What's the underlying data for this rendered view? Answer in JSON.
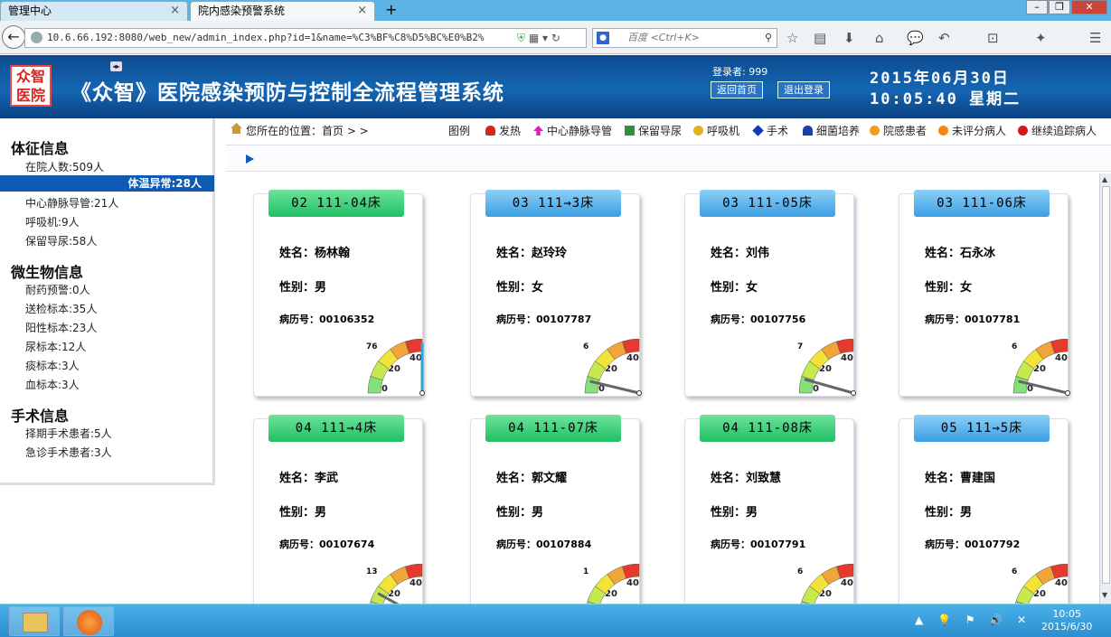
{
  "browser": {
    "tabs": [
      {
        "label": "管理中心"
      },
      {
        "label": "院内感染预警系统"
      }
    ],
    "new_tab": "+",
    "close_glyph": "×",
    "url": "10.6.66.192:8080/web_new/admin_index.php?id=1&name=%C3%BF%C8%D5%BC%E0%B2%",
    "search_placeholder": "百度 <Ctrl+K>",
    "window_buttons": {
      "min": "–",
      "max": "❐",
      "close": "✕"
    }
  },
  "header": {
    "title": "《众智》医院感染预防与控制全流程管理系统",
    "logo_text": "众智\n医院",
    "login_label": "登录者: 999",
    "home_button": "返回首页",
    "logout_button": "退出登录",
    "date": "2015年06月30日",
    "time": "10:05:40 星期二"
  },
  "sidebar": {
    "sections": [
      {
        "title": "体征信息",
        "items": [
          "在院人数:509人",
          "体温异常:28人",
          "中心静脉导管:21人",
          "呼吸机:9人",
          "保留导尿:58人"
        ]
      },
      {
        "title": "微生物信息",
        "items": [
          "耐药预警:0人",
          "送检标本:35人",
          "阳性标本:23人",
          "尿标本:12人",
          "痰标本:3人",
          "血标本:3人"
        ]
      },
      {
        "title": "手术信息",
        "items": [
          "择期手术患者:5人",
          "急诊手术患者:3人"
        ]
      }
    ],
    "active_item": "体温异常:28人"
  },
  "breadcrumb": "您所在的位置：首页 >  >",
  "legend": {
    "label": "图例",
    "items": [
      {
        "label": "发热",
        "color": "#d9261c",
        "icon": "fever-icon"
      },
      {
        "label": "中心静脉导管",
        "color": "#e01fb8",
        "icon": "catheter-icon"
      },
      {
        "label": "保留导尿",
        "color": "#2f8f3a",
        "icon": "urinary-icon"
      },
      {
        "label": "呼吸机",
        "color": "#e3b21a",
        "icon": "ventilator-icon"
      },
      {
        "label": "手术",
        "color": "#1437b8",
        "icon": "surgery-icon"
      },
      {
        "label": "细菌培养",
        "color": "#1c3fa8",
        "icon": "culture-icon"
      },
      {
        "label": "院感患者",
        "color": "#f0a020",
        "icon": "infection-icon"
      },
      {
        "label": "未评分病人",
        "color": "#f08a10",
        "icon": "unscored-icon"
      },
      {
        "label": "继续追踪病人",
        "color": "#d41818",
        "icon": "tracking-icon"
      }
    ]
  },
  "labels": {
    "name": "姓名：",
    "gender": "性别：",
    "record": "病历号："
  },
  "gauge_labels": {
    "min": "0",
    "mid": "20",
    "max": "40"
  },
  "patients": [
    {
      "bed": "02 111-04床",
      "name": "杨林翰",
      "gender": "男",
      "record": "00106352",
      "score": 76,
      "tab": "green"
    },
    {
      "bed": "03 111→3床",
      "name": "赵玲玲",
      "gender": "女",
      "record": "00107787",
      "score": 6,
      "tab": "blue"
    },
    {
      "bed": "03 111-05床",
      "name": "刘伟",
      "gender": "女",
      "record": "00107756",
      "score": 7,
      "tab": "blue"
    },
    {
      "bed": "03 111-06床",
      "name": "石永冰",
      "gender": "女",
      "record": "00107781",
      "score": 6,
      "tab": "blue"
    },
    {
      "bed": "04 111→4床",
      "name": "李武",
      "gender": "男",
      "record": "00107674",
      "score": 13,
      "tab": "green"
    },
    {
      "bed": "04 111-07床",
      "name": "郭文耀",
      "gender": "男",
      "record": "00107884",
      "score": 1,
      "tab": "green"
    },
    {
      "bed": "04 111-08床",
      "name": "刘致慧",
      "gender": "男",
      "record": "00107791",
      "score": 6,
      "tab": "green"
    },
    {
      "bed": "05 111→5床",
      "name": "曹建国",
      "gender": "男",
      "record": "00107792",
      "score": 6,
      "tab": "blue"
    }
  ],
  "taskbar": {
    "tray": "▲ 💡 ⚑ 🔊 ✕",
    "clock_time": "10:05",
    "clock_date": "2015/6/30"
  }
}
